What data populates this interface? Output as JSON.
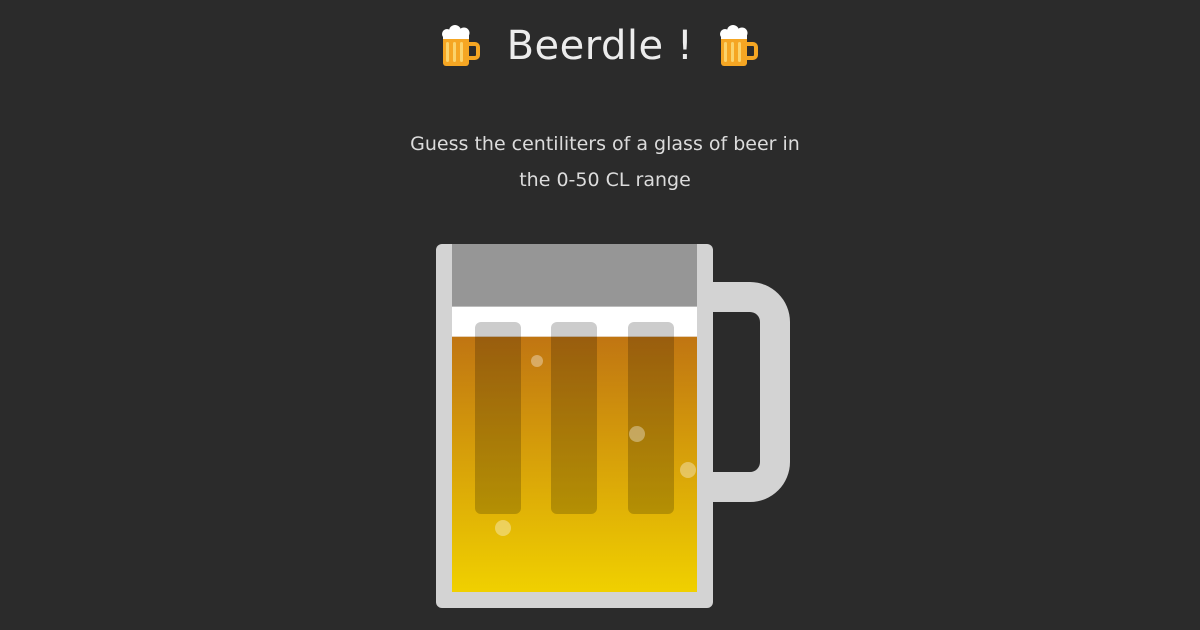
{
  "game": {
    "title": "Beerdle !",
    "title_icon": "beer-mug-icon",
    "instructions": "Guess the centiliters of a glass of beer in the 0-50 CL range"
  },
  "mug": {
    "fill_level_fraction": 0.82,
    "colors": {
      "background": "#2b2b2b",
      "glass_frame": "#d3d3d3",
      "empty_space": "#969696",
      "foam": "#ffffff",
      "beer_top": "#c07512",
      "beer_bottom": "#f0d000"
    }
  }
}
